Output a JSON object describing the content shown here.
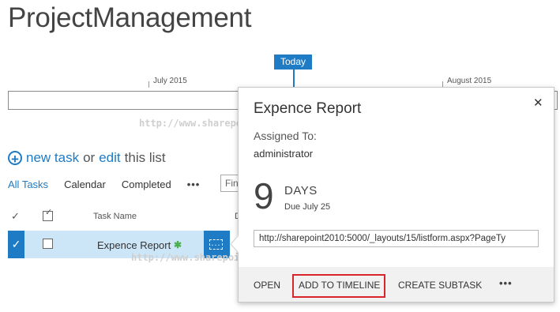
{
  "page": {
    "title": "ProjectManagement"
  },
  "timeline": {
    "today_label": "Today",
    "months": [
      "July 2015",
      "August 2015"
    ]
  },
  "watermarks": [
    "http://www.sharepointfordummies.net",
    "http://www.sharepointfordummies.net/"
  ],
  "list": {
    "new_task_label": "new task",
    "or_word": "or",
    "edit_label": "edit",
    "this_list_label": "this list",
    "views": [
      "All Tasks",
      "Calendar",
      "Completed"
    ],
    "more_views": "•••",
    "find_placeholder": "Fin",
    "columns": {
      "task_name": "Task Name",
      "d": "D"
    },
    "rows": [
      {
        "task_name": "Expence Report",
        "new_badge": "✱"
      }
    ]
  },
  "callout": {
    "title": "Expence Report",
    "assigned_label": "Assigned To:",
    "assigned_value": "administrator",
    "days_number": "9",
    "days_word": "DAYS",
    "due_text": "Due July 25",
    "url": "http://sharepoint2010:5000/_layouts/15/listform.aspx?PageTy",
    "actions": [
      "OPEN",
      "ADD TO TIMELINE",
      "CREATE SUBTASK"
    ],
    "more": "•••",
    "close_glyph": "✕"
  },
  "colors": {
    "accent": "#1f7bc4",
    "row_highlight": "#cde6f7",
    "annotation": "#d9242b"
  }
}
